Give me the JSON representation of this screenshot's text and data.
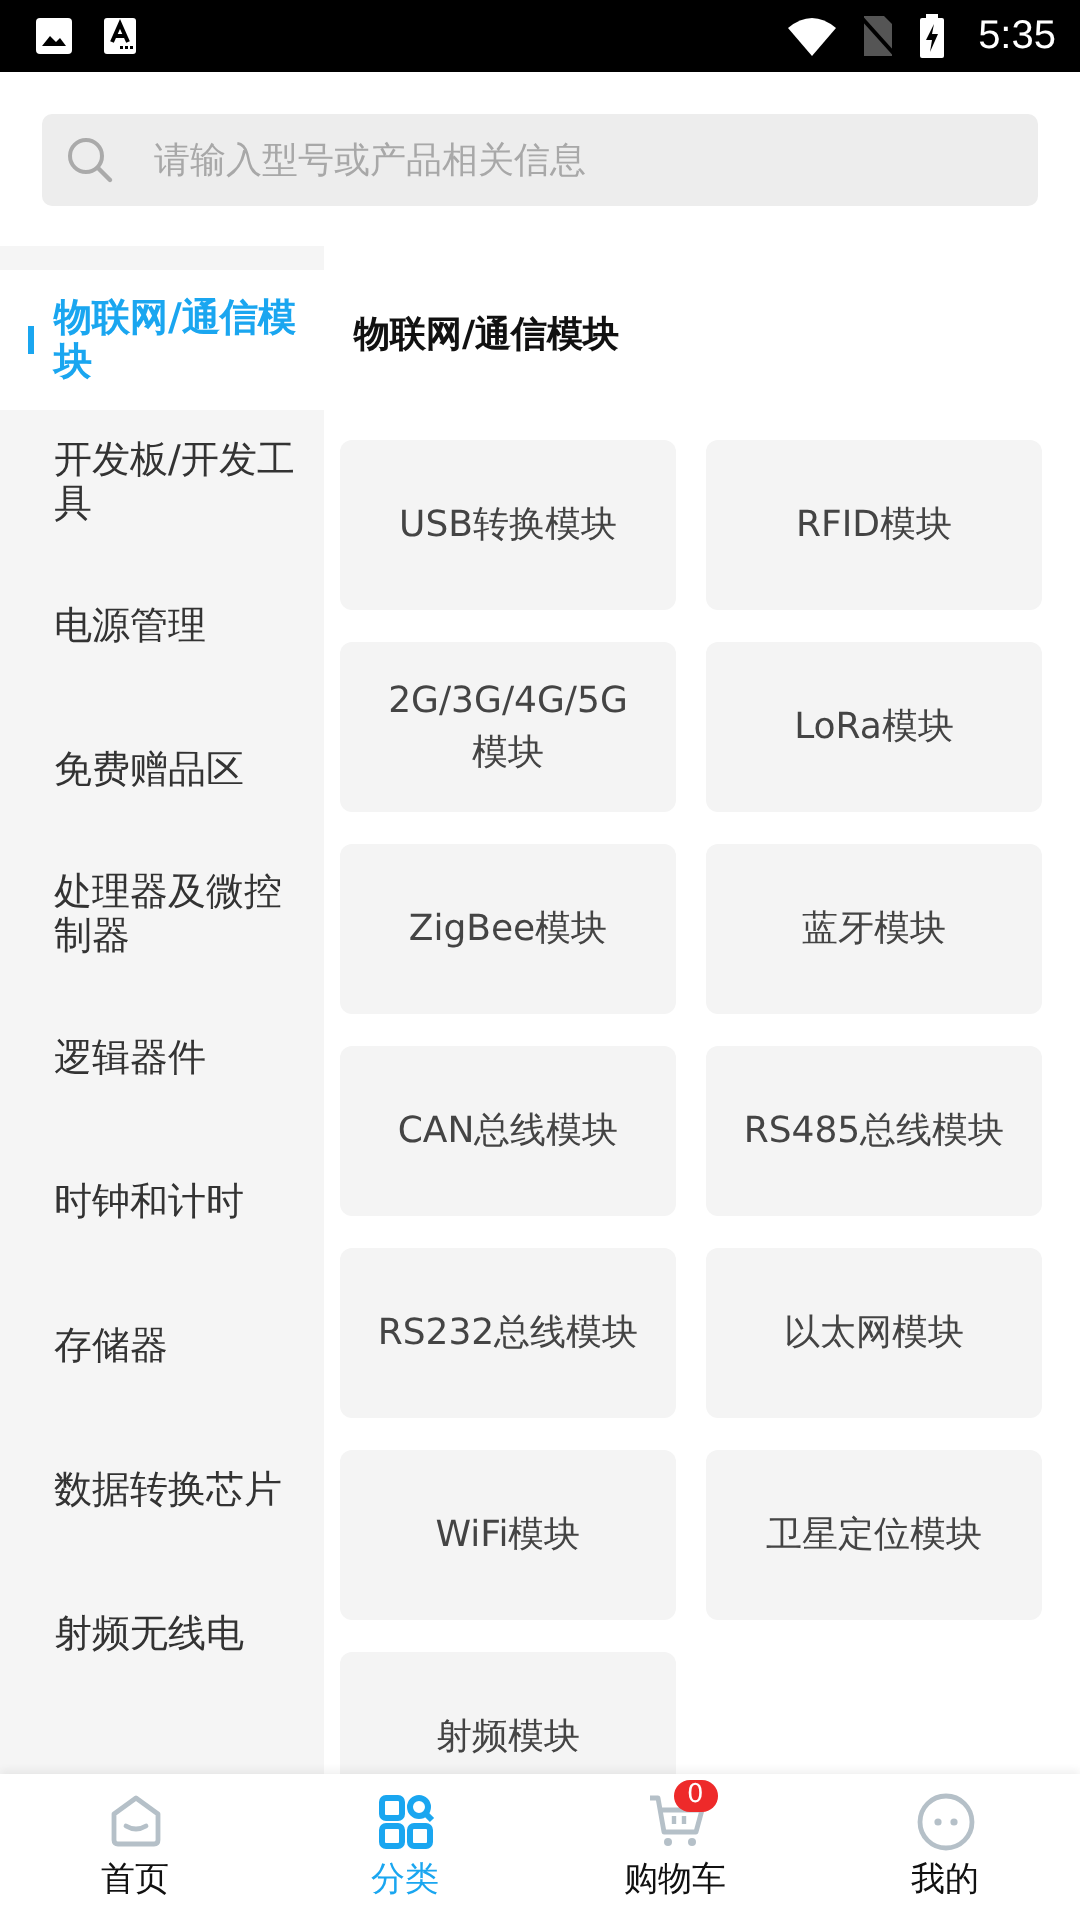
{
  "status_bar": {
    "time": "5:35"
  },
  "search": {
    "placeholder": "请输入型号或产品相关信息"
  },
  "sidebar": {
    "items": [
      {
        "label": "物联网/通信模块",
        "selected": true
      },
      {
        "label": "开发板/开发工具",
        "selected": false
      },
      {
        "label": "电源管理",
        "selected": false
      },
      {
        "label": "免费赠品区",
        "selected": false
      },
      {
        "label": "处理器及微控制器",
        "selected": false
      },
      {
        "label": "逻辑器件",
        "selected": false
      },
      {
        "label": "时钟和计时",
        "selected": false
      },
      {
        "label": "存储器",
        "selected": false
      },
      {
        "label": "数据转换芯片",
        "selected": false
      },
      {
        "label": "射频无线电",
        "selected": false
      }
    ]
  },
  "content": {
    "title": "物联网/通信模块",
    "items": [
      "USB转换模块",
      "RFID模块",
      "2G/3G/4G/5G模块",
      "LoRa模块",
      "ZigBee模块",
      "蓝牙模块",
      "CAN总线模块",
      "RS485总线模块",
      "RS232总线模块",
      "以太网模块",
      "WiFi模块",
      "卫星定位模块",
      "射频模块"
    ]
  },
  "tab_bar": {
    "tabs": [
      {
        "kind": "home",
        "label": "首页",
        "selected": false
      },
      {
        "kind": "category",
        "label": "分类",
        "selected": true
      },
      {
        "kind": "cart",
        "label": "购物车",
        "selected": false,
        "badge": "0"
      },
      {
        "kind": "me",
        "label": "我的",
        "selected": false
      }
    ]
  }
}
